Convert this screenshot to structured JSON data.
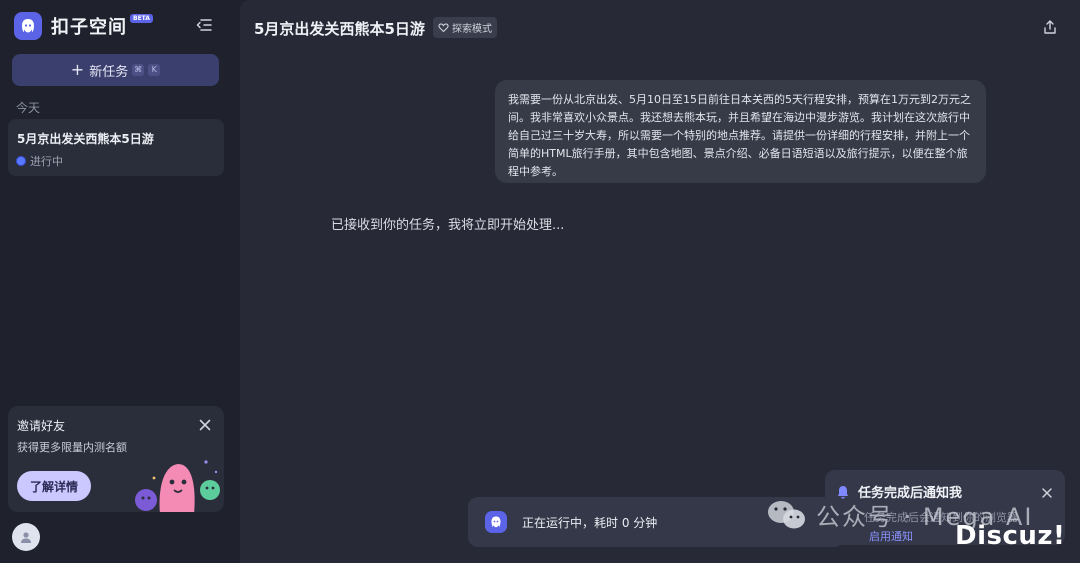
{
  "app": {
    "name": "扣子空间",
    "badge": "BETA"
  },
  "sidebar": {
    "new_task_label": "新任务",
    "new_task_keys": [
      "⌘",
      "K"
    ],
    "section_label": "今天",
    "tasks": [
      {
        "title": "5月京出发关西熊本5日游",
        "status": "进行中"
      }
    ],
    "invite": {
      "title": "邀请好友",
      "subtitle": "获得更多限量内测名额",
      "button": "了解详情"
    }
  },
  "header": {
    "title": "5月京出发关西熊本5日游",
    "mode_badge": "探索模式"
  },
  "chat": {
    "user_message": "我需要一份从北京出发、5月10日至15日前往日本关西的5天行程安排，预算在1万元到2万元之间。我非常喜欢小众景点。我还想去熊本玩，并且希望在海边中漫步游览。我计划在这次旅行中给自己过三十岁大寿，所以需要一个特别的地点推荐。请提供一份详细的行程安排，并附上一个简单的HTML旅行手册，其中包含地图、景点介绍、必备日语短语以及旅行提示，以便在整个旅程中参考。",
    "assistant_reply": "已接收到你的任务，我将立即开始处理..."
  },
  "status_bar": {
    "text": "正在运行中，耗时 0 分钟"
  },
  "notify": {
    "title": "任务完成后通知我",
    "subtitle": "任务完成后会通知到你的浏览器",
    "link": "启用通知"
  },
  "watermark": {
    "wechat": "公众号 · Mega AI",
    "site": "Discuz!"
  },
  "colors": {
    "accent": "#5b63e6",
    "background": "#1f222d",
    "panel": "#272a36"
  }
}
